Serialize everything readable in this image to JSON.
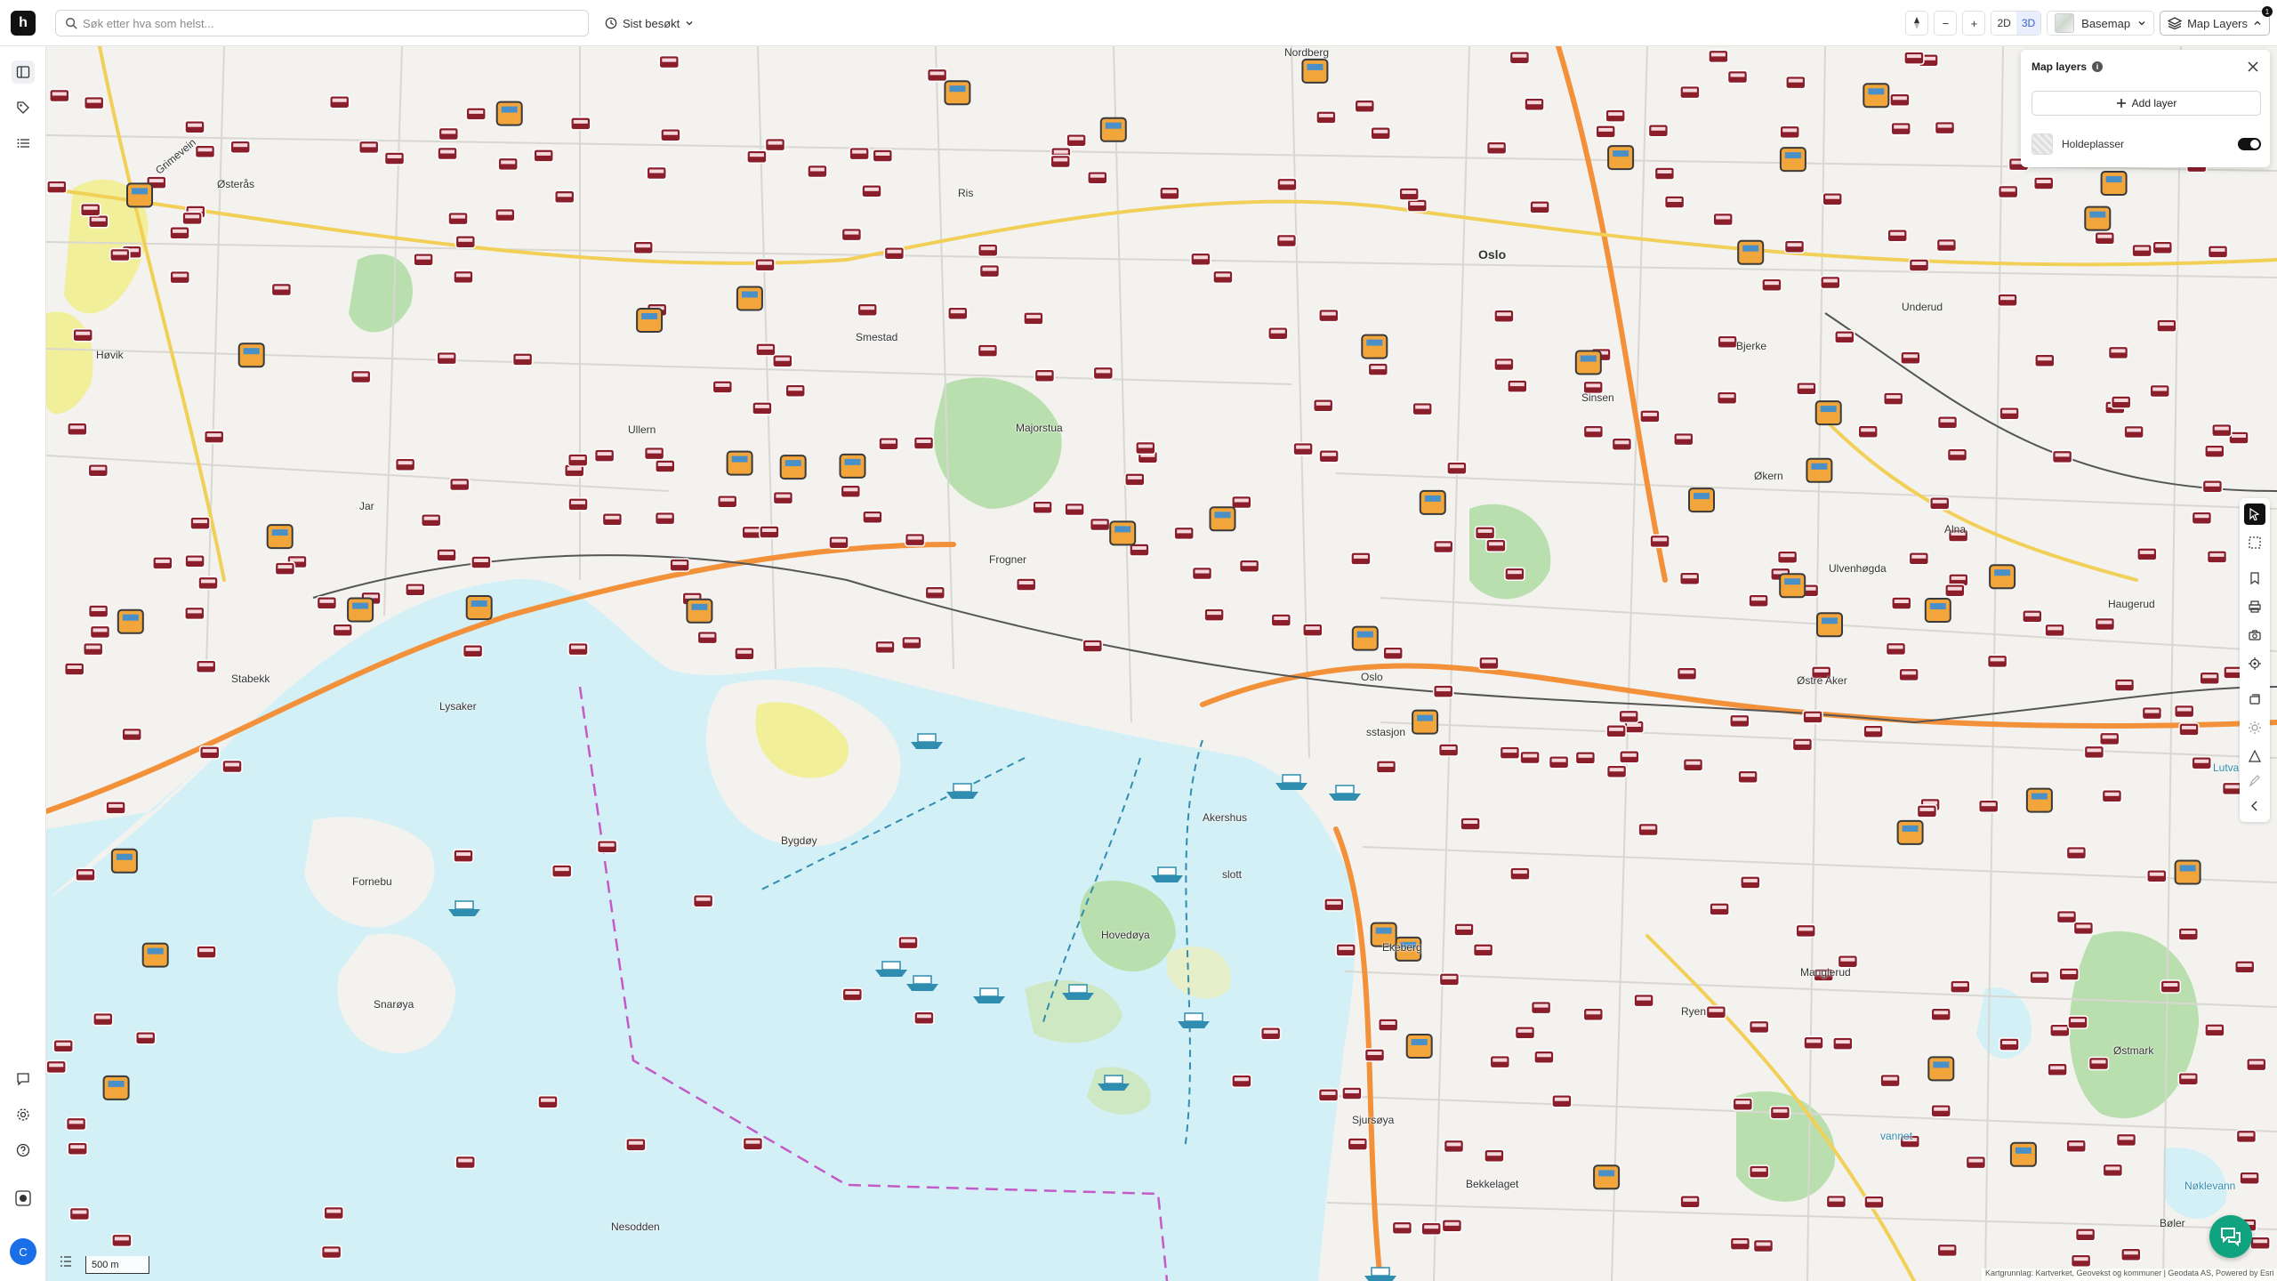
{
  "app": {
    "logo_letter": "h"
  },
  "search": {
    "placeholder": "Søk etter hva som helst...",
    "value": ""
  },
  "recent": {
    "label": "Sist besøkt"
  },
  "toolbar": {
    "zoom_out": "−",
    "zoom_in": "+",
    "mode_2d": "2D",
    "mode_3d": "3D",
    "active_mode": "3D",
    "basemap_label": "Basemap",
    "map_layers_label": "Map Layers",
    "map_layers_badge": "1"
  },
  "layers_panel": {
    "title": "Map layers",
    "info": "i",
    "add_layer_label": "Add layer",
    "items": [
      {
        "label": "Holdeplasser",
        "enabled": true
      }
    ]
  },
  "map": {
    "places": [
      {
        "name": "Oslo",
        "big": true
      },
      {
        "name": "Oslo",
        "big": false
      },
      {
        "name": "Nordberg"
      },
      {
        "name": "Ris"
      },
      {
        "name": "Smestad"
      },
      {
        "name": "Ullern"
      },
      {
        "name": "Majorstua"
      },
      {
        "name": "Frogner"
      },
      {
        "name": "Sinsen"
      },
      {
        "name": "Bjerke"
      },
      {
        "name": "Økern"
      },
      {
        "name": "Alna"
      },
      {
        "name": "Haugerud"
      },
      {
        "name": "Østre Aker"
      },
      {
        "name": "Ekeberg"
      },
      {
        "name": "Ryen"
      },
      {
        "name": "Manglerud"
      },
      {
        "name": "Bygdøy"
      },
      {
        "name": "Akershus"
      },
      {
        "name": "slott"
      },
      {
        "name": "Hovedøya"
      },
      {
        "name": "Sjursøya"
      },
      {
        "name": "Bekkelaget"
      },
      {
        "name": "Nesodden"
      },
      {
        "name": "Snarøya"
      },
      {
        "name": "Fornebu"
      },
      {
        "name": "Lysaker"
      },
      {
        "name": "Stabekk"
      },
      {
        "name": "Jar"
      },
      {
        "name": "Høvik"
      },
      {
        "name": "Østerås"
      },
      {
        "name": "Grimevein"
      },
      {
        "name": "Ulvenhøgda"
      },
      {
        "name": "Lutvann"
      },
      {
        "name": "Østmark"
      },
      {
        "name": "Bøler"
      },
      {
        "name": "Nøklevann"
      },
      {
        "name": "vannet"
      },
      {
        "name": "sstasjon"
      },
      {
        "name": "Underud"
      }
    ],
    "scale_label": "500 m",
    "attribution": "Kartgrunnlag: Kartverket, Geovekst og kommuner | Geodata AS, Powered by Esri"
  },
  "colors": {
    "water": "#d4f0f7",
    "land": "#f3f2ef",
    "green": "#b9dfae",
    "road_major": "#f2913a",
    "road_minor": "#f2cf57",
    "stop_icon": "#8a1f2b",
    "chat": "#0fa37f",
    "avatar": "#1a6ee8"
  },
  "user": {
    "initial": "C"
  }
}
